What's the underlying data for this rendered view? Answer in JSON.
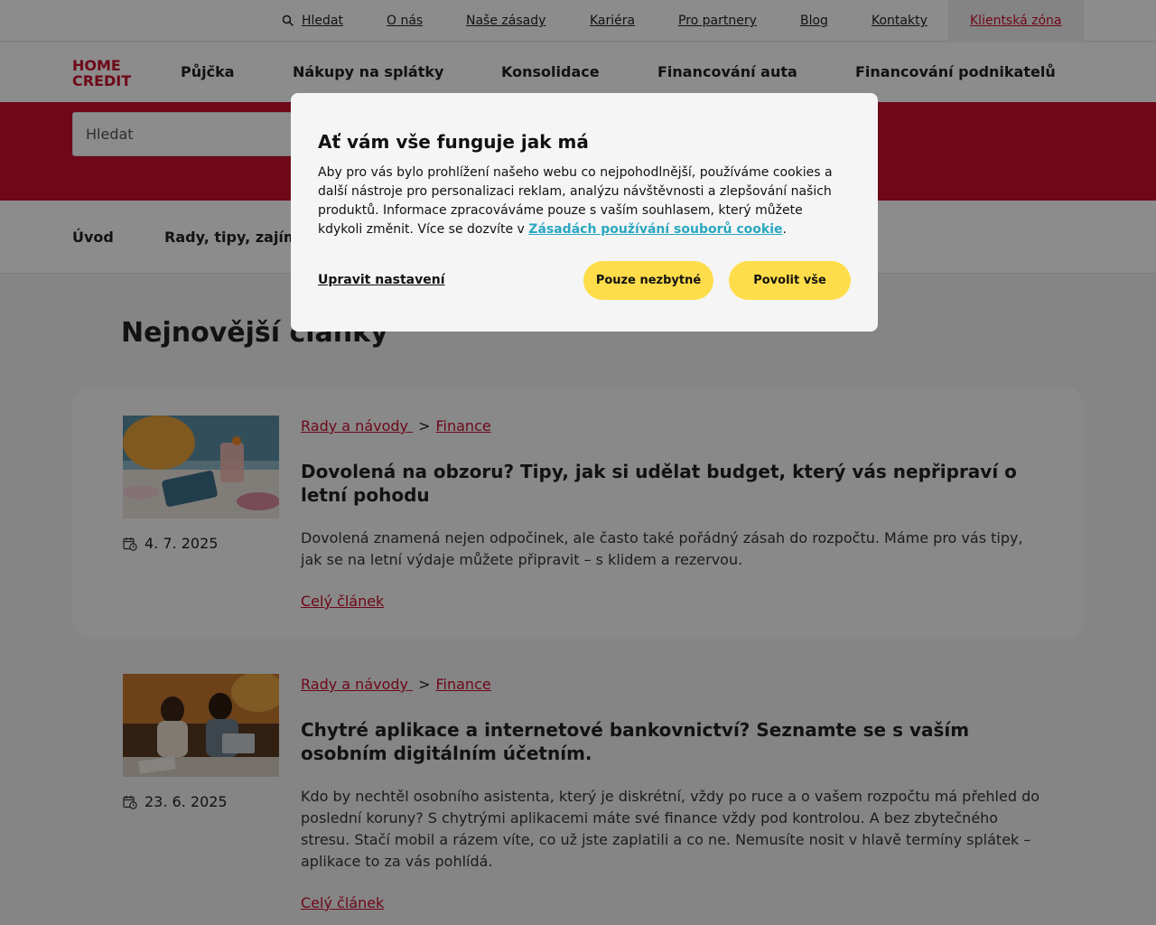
{
  "topbar": {
    "search_label": "Hledat",
    "links": [
      "O nás",
      "Naše zásady",
      "Kariéra",
      "Pro partnery",
      "Blog",
      "Kontakty"
    ],
    "client_zone": "Klientská zóna"
  },
  "logo": {
    "line1": "HOME",
    "line2": "CREDIT"
  },
  "mainnav": [
    "Půjčka",
    "Nákupy na splátky",
    "Konsolidace",
    "Financování auta",
    "Financování podnikatelů"
  ],
  "hero": {
    "search_placeholder": "Hledat"
  },
  "subnav": [
    "Úvod",
    "Rady, tipy, zajím"
  ],
  "section_title": "Nejnovější články",
  "articles": [
    {
      "crumb1": "Rady a návody ",
      "crumb_sep": ">",
      "crumb2": "Finance",
      "title": "Dovolená na obzoru? Tipy, jak si udělat budget, který vás nepřipraví o letní pohodu",
      "text": "Dovolená znamená nejen odpočinek, ale často také pořádný zásah do rozpočtu. Máme pro vás tipy, jak se na letní výdaje můžete připravit – s klidem a rezervou.",
      "date": "4. 7. 2025",
      "more": "Celý článek"
    },
    {
      "crumb1": "Rady a návody ",
      "crumb_sep": ">",
      "crumb2": "Finance",
      "title": "Chytré aplikace a internetové bankovnictví? Seznamte se s vaším osobním digitálním účetním.",
      "text": "Kdo by nechtěl osobního asistenta, který je diskrétní, vždy po ruce a o vašem rozpočtu má přehled do poslední koruny? S chytrými aplikacemi máte své finance vždy pod kontrolou. A bez zbytečného stresu. Stačí mobil a rázem víte, co už jste zaplatili a co ne. Nemusíte nosit v hlavě termíny splátek – aplikace to za vás pohlídá.",
      "date": "23. 6. 2025",
      "more": "Celý článek"
    }
  ],
  "cookie_dialog": {
    "title": "Ať vám vše funguje jak má",
    "text_before": "Aby pro vás bylo prohlížení našeho webu co nejpohodlnější, používáme cookies a další nástroje pro personalizaci reklam, analýzu návštěvnosti a zlepšování našich produktů. Informace zpracováváme pouze s vaším souhlasem, který můžete kdykoli změnit. Více se dozvíte v ",
    "link": "Zásadách používání souborů cookie",
    "text_after": ".",
    "settings_label": "Upravit nastavení",
    "necessary_label": "Pouze nezbytné",
    "allow_all_label": "Povolit vše"
  },
  "colors": {
    "brand_red": "#c8102e",
    "button_yellow": "#ffdd4a",
    "link_cyan": "#2aa7c0"
  }
}
